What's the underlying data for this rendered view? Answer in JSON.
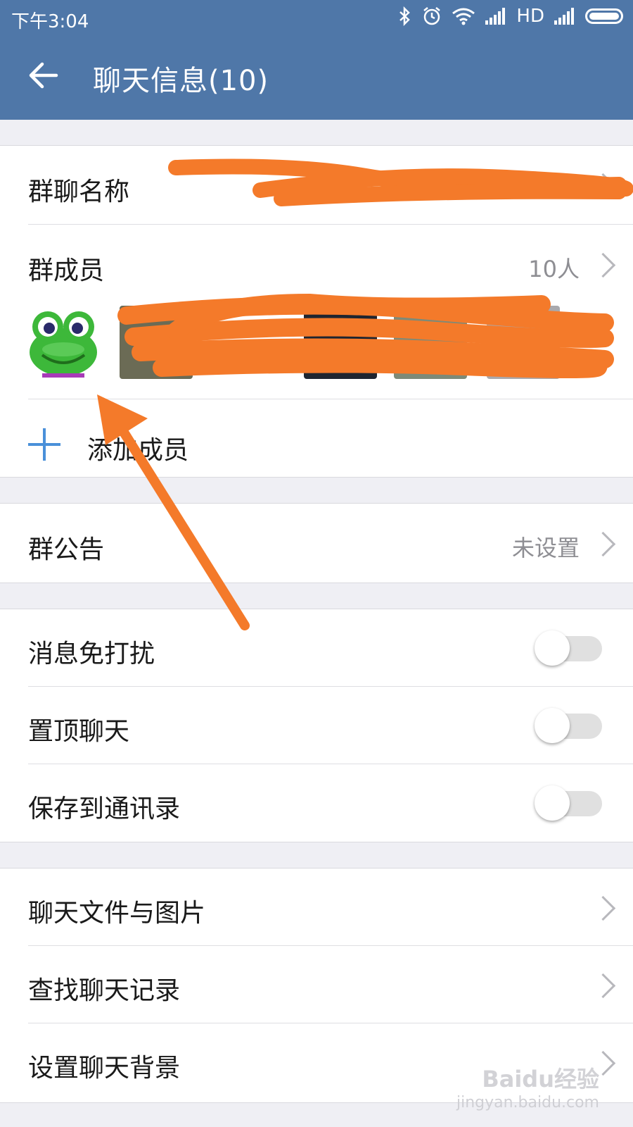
{
  "status_bar": {
    "time": "下午3:04",
    "network": "HD"
  },
  "header": {
    "title": "聊天信息(10)"
  },
  "group_name": {
    "label": "群聊名称"
  },
  "members": {
    "label": "群成员",
    "count": "10人",
    "add_label": "添加成员"
  },
  "announcement": {
    "label": "群公告",
    "value": "未设置"
  },
  "toggles": [
    {
      "label": "消息免打扰",
      "on": false
    },
    {
      "label": "置顶聊天",
      "on": false
    },
    {
      "label": "保存到通讯录",
      "on": false
    }
  ],
  "links": [
    {
      "label": "聊天文件与图片"
    },
    {
      "label": "查找聊天记录"
    },
    {
      "label": "设置聊天背景"
    }
  ],
  "watermark": {
    "brand": "Baidu经验",
    "url": "jingyan.baidu.com"
  },
  "colors": {
    "header": "#4f77a8",
    "accent": "#4a90d9",
    "scribble": "#f47a2a"
  }
}
